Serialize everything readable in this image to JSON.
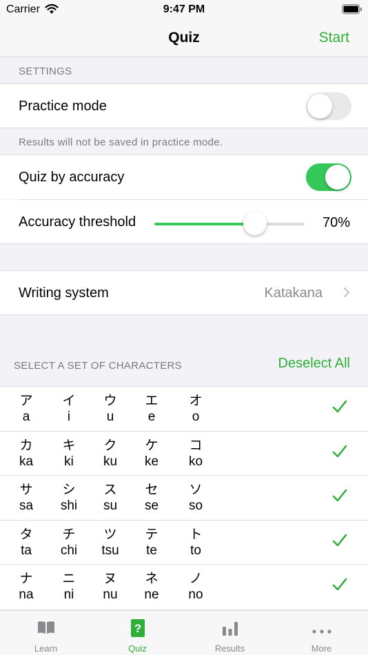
{
  "status": {
    "carrier": "Carrier",
    "time": "9:47 PM"
  },
  "nav": {
    "title": "Quiz",
    "start_label": "Start"
  },
  "settings": {
    "header": "SETTINGS",
    "practice_mode_label": "Practice mode",
    "practice_mode_on": false,
    "practice_note": "Results will not be saved in practice mode.",
    "quiz_by_accuracy_label": "Quiz by accuracy",
    "quiz_by_accuracy_on": true,
    "accuracy_threshold_label": "Accuracy threshold",
    "accuracy_threshold_value": "70%",
    "accuracy_threshold_fraction": 0.67
  },
  "writing": {
    "label": "Writing system",
    "value": "Katakana"
  },
  "characters": {
    "header": "SELECT A SET OF CHARACTERS",
    "deselect_label": "Deselect All",
    "rows": [
      {
        "kana": [
          "ア",
          "イ",
          "ウ",
          "エ",
          "オ"
        ],
        "romaji": [
          "a",
          "i",
          "u",
          "e",
          "o"
        ],
        "selected": true
      },
      {
        "kana": [
          "カ",
          "キ",
          "ク",
          "ケ",
          "コ"
        ],
        "romaji": [
          "ka",
          "ki",
          "ku",
          "ke",
          "ko"
        ],
        "selected": true
      },
      {
        "kana": [
          "サ",
          "シ",
          "ス",
          "セ",
          "ソ"
        ],
        "romaji": [
          "sa",
          "shi",
          "su",
          "se",
          "so"
        ],
        "selected": true
      },
      {
        "kana": [
          "タ",
          "チ",
          "ツ",
          "テ",
          "ト"
        ],
        "romaji": [
          "ta",
          "chi",
          "tsu",
          "te",
          "to"
        ],
        "selected": true
      },
      {
        "kana": [
          "ナ",
          "ニ",
          "ヌ",
          "ネ",
          "ノ"
        ],
        "romaji": [
          "na",
          "ni",
          "nu",
          "ne",
          "no"
        ],
        "selected": true
      }
    ]
  },
  "tabs": [
    {
      "label": "Learn",
      "icon": "book-icon",
      "active": false
    },
    {
      "label": "Quiz",
      "icon": "question-icon",
      "active": true
    },
    {
      "label": "Results",
      "icon": "bar-chart-icon",
      "active": false
    },
    {
      "label": "More",
      "icon": "more-icon",
      "active": false
    }
  ],
  "colors": {
    "accent": "#2fae3a",
    "toggle_on": "#34c759",
    "secondary_text": "#8a8a8e"
  }
}
